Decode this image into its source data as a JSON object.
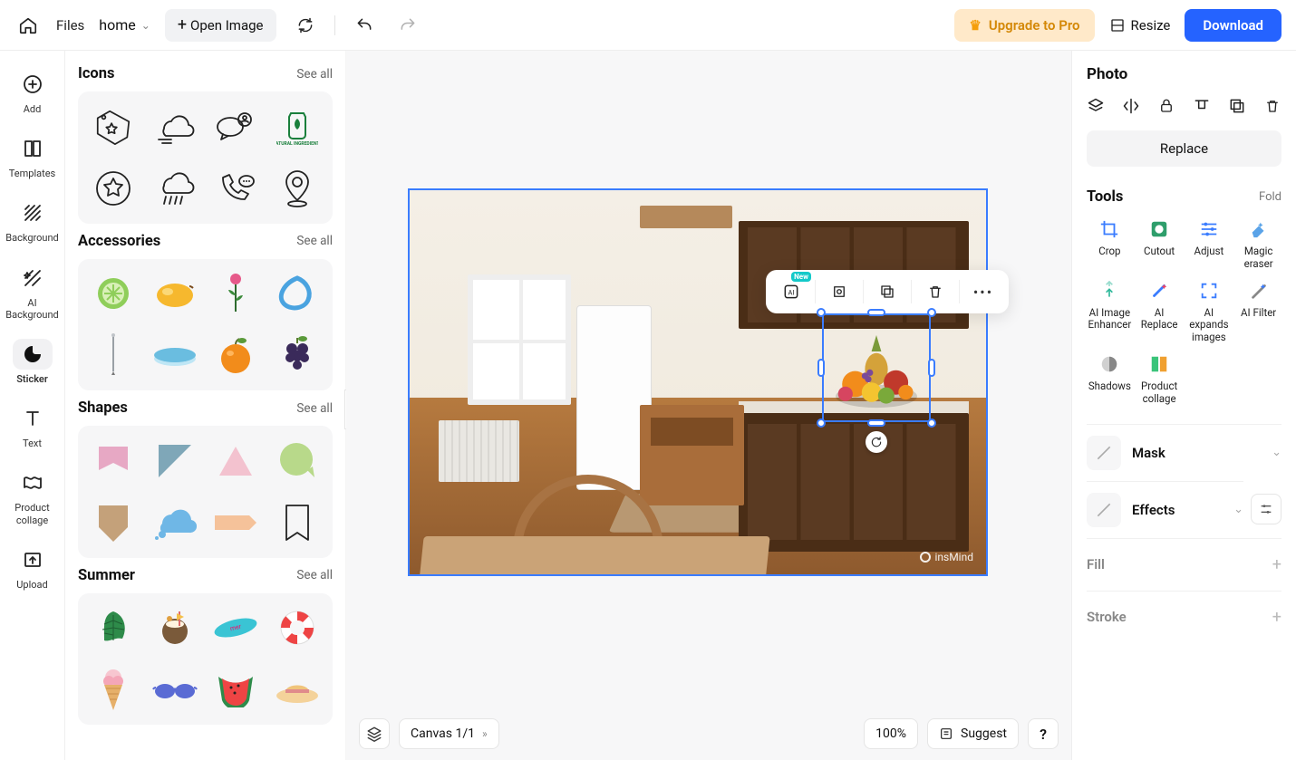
{
  "topbar": {
    "files": "Files",
    "home": "home",
    "open_image": "Open Image",
    "upgrade": "Upgrade to Pro",
    "resize": "Resize",
    "download": "Download"
  },
  "rail": {
    "add": "Add",
    "templates": "Templates",
    "background": "Background",
    "ai_background": "AI Background",
    "sticker": "Sticker",
    "text": "Text",
    "product_collage": "Product collage",
    "upload": "Upload"
  },
  "panel": {
    "see_all": "See all",
    "sections": {
      "icons": "Icons",
      "accessories": "Accessories",
      "shapes": "Shapes",
      "summer": "Summer"
    },
    "icon_items": [
      "tag-star-icon",
      "cloud-wind-icon",
      "chat-user-icon",
      "natural-ingredients-icon",
      "star-badge-icon",
      "cloud-rain-icon",
      "phone-chat-icon",
      "location-pin-icon"
    ],
    "natural_label": "NATURAL INGREDIENTS",
    "accessory_items": [
      "cucumber",
      "mango",
      "rose",
      "water-splash",
      "needle",
      "water-tray",
      "orange",
      "grapes"
    ],
    "shape_items": [
      "ribbon-pink",
      "triangle-cut-blue",
      "triangle-pink",
      "speech-round-green",
      "shield-tan",
      "cloud-blue",
      "tag-peach",
      "bookmark-outline"
    ],
    "summer_items": [
      "monstera-leaf",
      "coconut-drink",
      "surfboard",
      "lifebuoy",
      "ice-cream",
      "sunglasses",
      "watermelon",
      "sun-hat"
    ]
  },
  "canvas": {
    "watermark": "insMind",
    "new_badge": "New",
    "canvas_chip": "Canvas 1/1",
    "zoom": "100%",
    "suggest": "Suggest",
    "help": "?"
  },
  "right": {
    "photo": "Photo",
    "replace": "Replace",
    "tools": "Tools",
    "fold": "Fold",
    "tool_items": {
      "crop": "Crop",
      "cutout": "Cutout",
      "adjust": "Adjust",
      "magic_eraser": "Magic eraser",
      "ai_enhancer": "AI Image Enhancer",
      "ai_replace": "AI Replace",
      "ai_expand": "AI expands images",
      "ai_filter": "AI Filter",
      "shadows": "Shadows",
      "product_collage": "Product collage"
    },
    "mask": "Mask",
    "effects": "Effects",
    "fill": "Fill",
    "stroke": "Stroke"
  }
}
